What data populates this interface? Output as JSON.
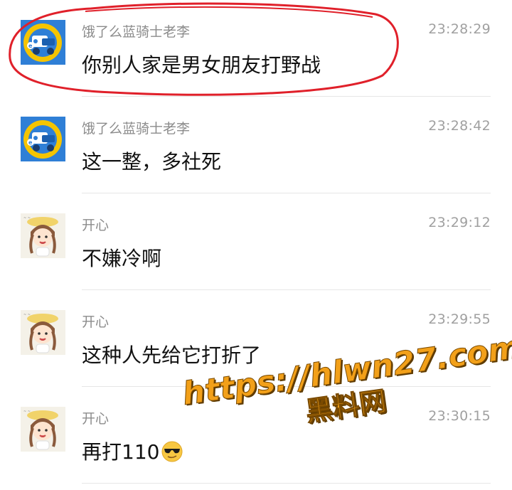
{
  "messages": [
    {
      "sender": "饿了么蓝骑士老李",
      "time": "23:28:29",
      "text": "你别人家是男女朋友打野战",
      "avatar": "rider-avatar-icon"
    },
    {
      "sender": "饿了么蓝骑士老李",
      "time": "23:28:42",
      "text": "这一整，多社死",
      "avatar": "rider-avatar-icon"
    },
    {
      "sender": "开心",
      "time": "23:29:12",
      "text": "不嫌冷啊",
      "avatar": "girl-avatar-icon"
    },
    {
      "sender": "开心",
      "time": "23:29:55",
      "text": "这种人先给它打折了",
      "avatar": "girl-avatar-icon"
    },
    {
      "sender": "开心",
      "time": "23:30:15",
      "text": "再打110",
      "avatar": "girl-avatar-icon",
      "emoji": "sunglasses-emoji-icon"
    }
  ],
  "watermark": {
    "url": "https://hlwn27.com",
    "name": "黑料网"
  },
  "colors": {
    "annotation_circle": "#e0202a",
    "rider_avatar_bg": "#2f7fd6",
    "rider_avatar_ring": "#f5c400",
    "watermark_fill": "#f2a019"
  }
}
